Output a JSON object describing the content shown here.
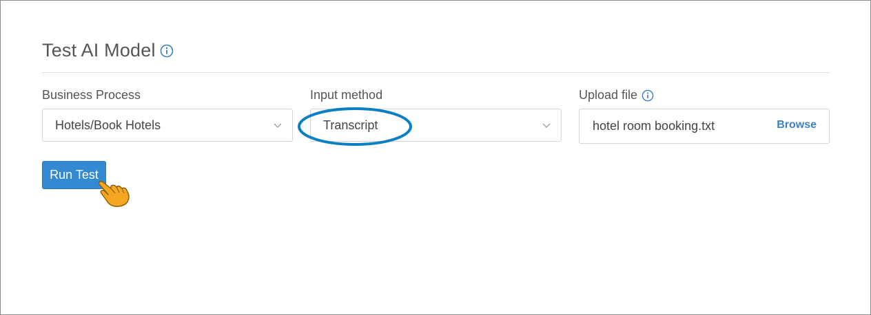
{
  "header": {
    "title": "Test AI Model",
    "title_icon": "info-icon"
  },
  "form": {
    "business_process": {
      "label": "Business Process",
      "value": "Hotels/Book Hotels"
    },
    "input_method": {
      "label": "Input method",
      "value": "Transcript"
    },
    "upload_file": {
      "label": "Upload file",
      "label_icon": "info-icon",
      "value": "hotel room booking.txt",
      "browse_label": "Browse"
    }
  },
  "actions": {
    "run_test_label": "Run Test"
  },
  "colors": {
    "accent": "#3489d3",
    "annotation": "#0a7fc4",
    "cursor": "#f5a623"
  }
}
